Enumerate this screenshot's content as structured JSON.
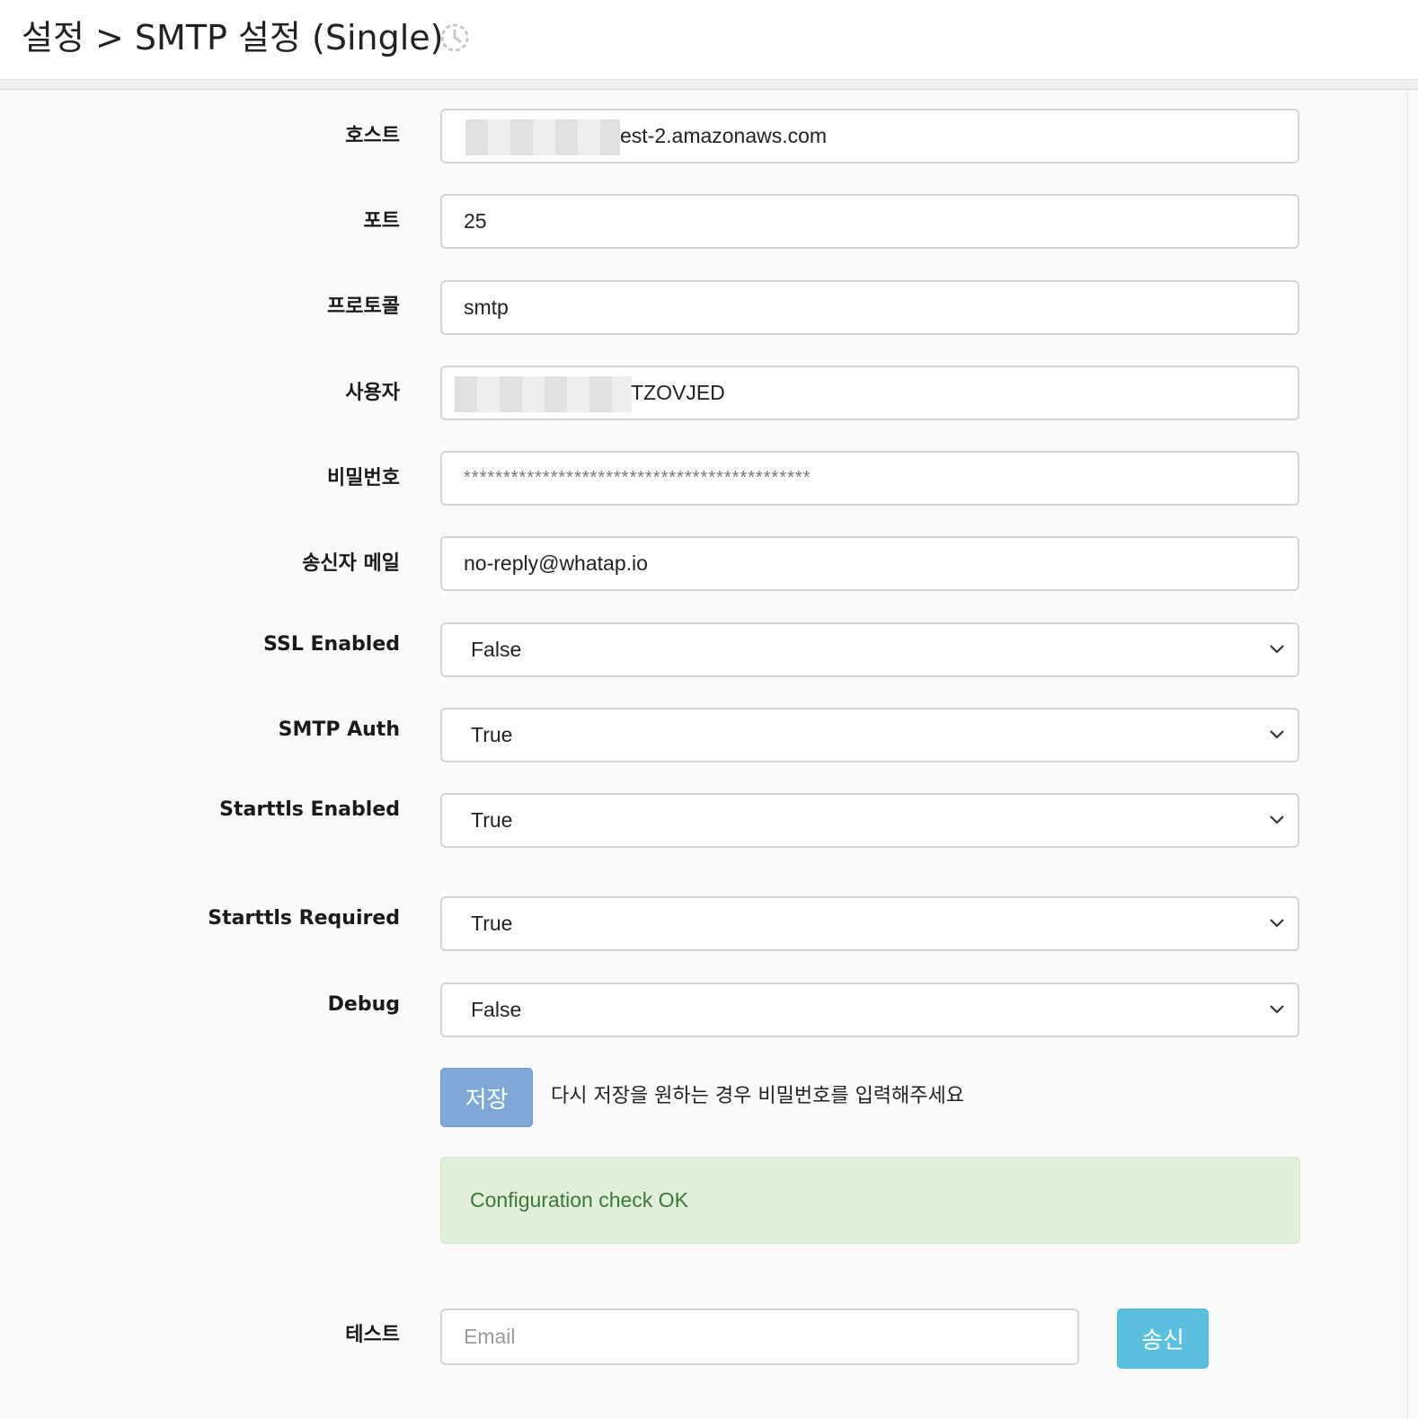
{
  "header": {
    "title": "설정 > SMTP 설정 (Single)",
    "history_icon": "history-icon"
  },
  "form": {
    "host": {
      "label": "호스트",
      "value": "est-2.amazonaws.com"
    },
    "port": {
      "label": "포트",
      "value": "25"
    },
    "protocol": {
      "label": "프로토콜",
      "value": "smtp"
    },
    "user": {
      "label": "사용자",
      "value": "TZOVJED"
    },
    "password": {
      "label": "비밀번호",
      "value": "********************************************"
    },
    "sender": {
      "label": "송신자 메일",
      "value": "no-reply@whatap.io"
    },
    "ssl_enabled": {
      "label": "SSL Enabled",
      "value": "False"
    },
    "smtp_auth": {
      "label": "SMTP Auth",
      "value": "True"
    },
    "starttls_enabled": {
      "label": "Starttls Enabled",
      "value": "True"
    },
    "starttls_required": {
      "label": "Starttls Required",
      "value": "True"
    },
    "debug": {
      "label": "Debug",
      "value": "False"
    }
  },
  "actions": {
    "save_label": "저장",
    "hint": "다시 저장을 원하는 경우 비밀번호를 입력해주세요"
  },
  "status": {
    "message": "Configuration check OK",
    "color": "#3c763d"
  },
  "test": {
    "label": "테스트",
    "placeholder": "Email",
    "send_label": "송신"
  },
  "colors": {
    "save_button": "#7fa8d6",
    "send_button": "#5bc0de",
    "alert_bg": "#dfefd8"
  }
}
